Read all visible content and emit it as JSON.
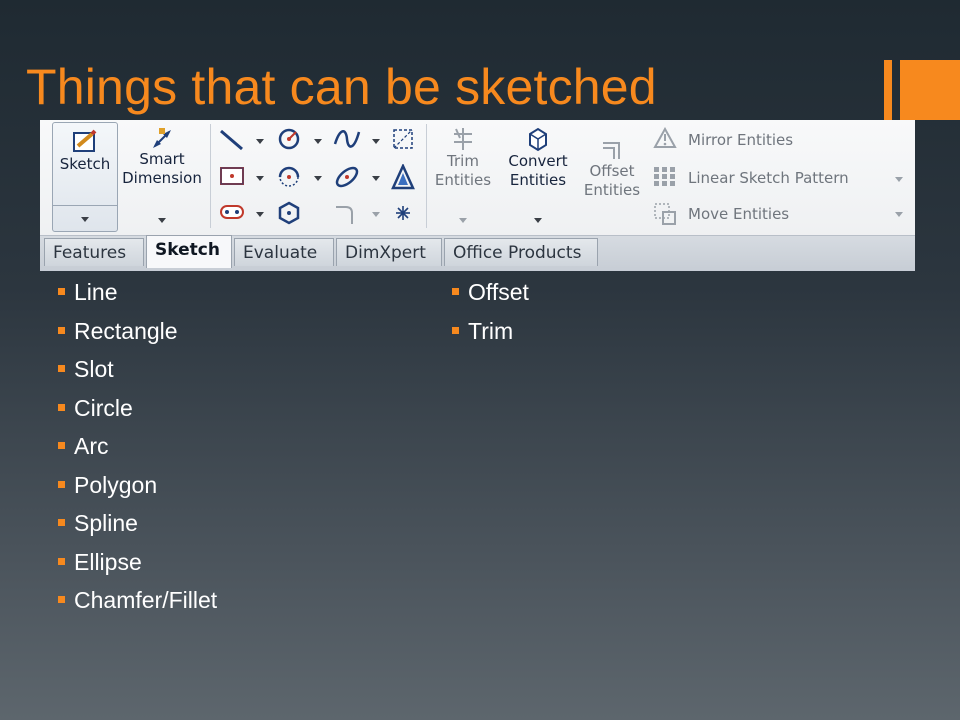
{
  "slide": {
    "title": "Things that can be sketched",
    "accent_color": "#f7891e"
  },
  "ribbon": {
    "sketch": {
      "label": "Sketch",
      "icon": "sketch-pencil-icon"
    },
    "smart_dimension": {
      "label_line1": "Smart",
      "label_line2": "Dimension",
      "icon": "dimension-icon"
    },
    "trim": {
      "label_line1": "Trim",
      "label_line2": "Entities",
      "icon": "trim-icon"
    },
    "convert": {
      "label_line1": "Convert",
      "label_line2": "Entities",
      "icon": "cube-icon"
    },
    "offset": {
      "label_line1": "Offset",
      "label_line2": "Entities",
      "icon": "offset-icon"
    },
    "mirror": {
      "label": "Mirror Entities",
      "icon": "mirror-icon"
    },
    "linear_pattern": {
      "label": "Linear Sketch Pattern",
      "icon": "grid-pattern-icon"
    },
    "move": {
      "label": "Move Entities",
      "icon": "move-icon"
    }
  },
  "tabs": [
    "Features",
    "Sketch",
    "Evaluate",
    "DimXpert",
    "Office Products"
  ],
  "bullets_left": [
    "Line",
    "Rectangle",
    "Slot",
    "Circle",
    "Arc",
    "Polygon",
    "Spline",
    "Ellipse",
    "Chamfer/Fillet"
  ],
  "bullets_right": [
    "Offset",
    "Trim"
  ]
}
